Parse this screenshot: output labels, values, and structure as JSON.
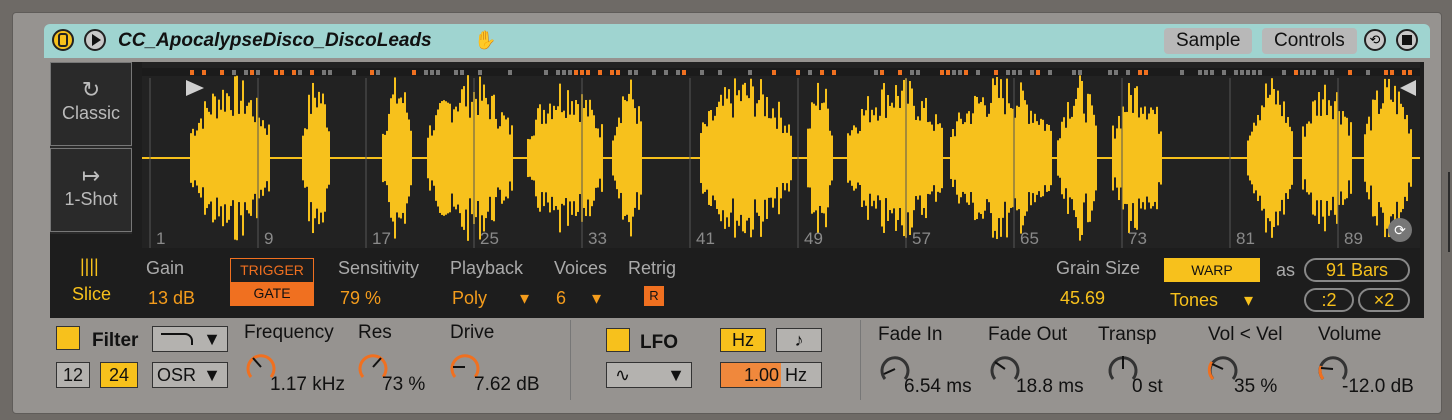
{
  "header": {
    "title": "CC_ApocalypseDisco_DiscoLeads",
    "tabs": [
      {
        "label": "Sample"
      },
      {
        "label": "Controls"
      }
    ]
  },
  "modes": [
    {
      "label": "Classic",
      "icon": "loop-icon"
    },
    {
      "label": "1-Shot",
      "icon": "arrow-to-bar-icon"
    }
  ],
  "waveform": {
    "bar_markers": [
      "1",
      "9",
      "17",
      "25",
      "33",
      "41",
      "49",
      "57",
      "65",
      "73",
      "81",
      "89"
    ]
  },
  "controls": {
    "slice_label": "Slice",
    "gain_label": "Gain",
    "gain_value": "13 dB",
    "trigger_label": "TRIGGER",
    "gate_label": "GATE",
    "sensitivity_label": "Sensitivity",
    "sensitivity_value": "79 %",
    "playback_label": "Playback",
    "playback_value": "Poly",
    "voices_label": "Voices",
    "voices_value": "6",
    "retrig_label": "Retrig",
    "retrig_value": "R",
    "grain_label": "Grain Size",
    "grain_value": "45.69",
    "warp_label": "WARP",
    "warp_mode": "Tones",
    "as_label": "as",
    "length": "91 Bars",
    "half_label": ":2",
    "double_label": "×2"
  },
  "bottom": {
    "filter_label": "Filter",
    "slope_12": "12",
    "slope_24": "24",
    "filter_type": "OSR",
    "frequency_label": "Frequency",
    "frequency_value": "1.17 kHz",
    "res_label": "Res",
    "res_value": "73 %",
    "drive_label": "Drive",
    "drive_value": "7.62 dB",
    "lfo_label": "LFO",
    "hz_label": "Hz",
    "note_label": "♪",
    "rate_value": "1.00",
    "rate_unit": "Hz",
    "fade_in_label": "Fade In",
    "fade_in_value": "6.54 ms",
    "fade_out_label": "Fade Out",
    "fade_out_value": "18.8 ms",
    "transp_label": "Transp",
    "transp_value": "0 st",
    "vel_label": "Vol < Vel",
    "vel_value": "35 %",
    "volume_label": "Volume",
    "volume_value": "-12.0 dB"
  },
  "colors": {
    "accent": "#f7c11c",
    "orange": "#f07020",
    "header": "#9fd4d0"
  }
}
